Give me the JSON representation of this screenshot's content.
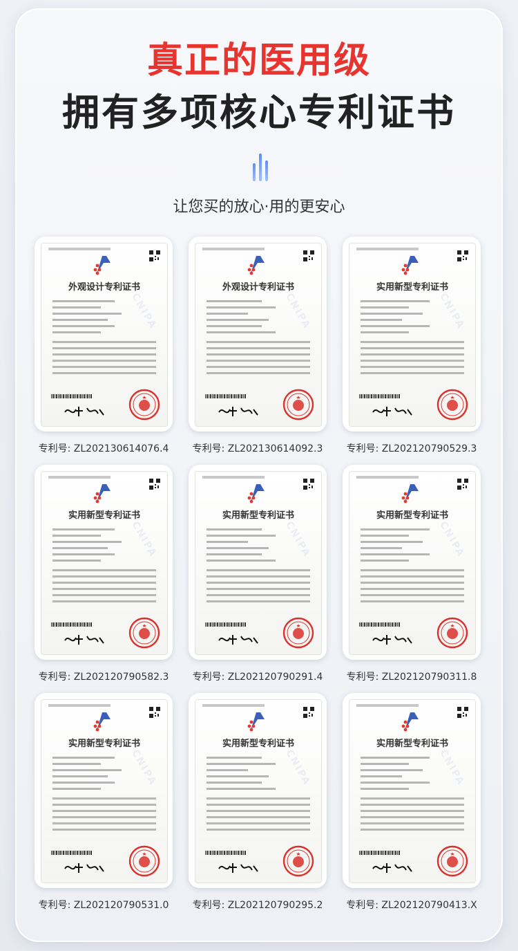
{
  "header": {
    "title_red": "真正的医用级",
    "title_black": "拥有多项核心专利证书",
    "subtitle": "让您买的放心·用的更安心"
  },
  "colors": {
    "accent_red": "#e8342f",
    "accent_blue": "#3a6fe0",
    "seal_red": "#d9312c"
  },
  "certificates": [
    {
      "cert_title": "外观设计专利证书",
      "caption": "专利号: ZL202130614076.4"
    },
    {
      "cert_title": "外观设计专利证书",
      "caption": "专利号: ZL202130614092.3"
    },
    {
      "cert_title": "实用新型专利证书",
      "caption": "专利号: ZL202120790529.3"
    },
    {
      "cert_title": "实用新型专利证书",
      "caption": "专利号: ZL202120790582.3"
    },
    {
      "cert_title": "实用新型专利证书",
      "caption": "专利号: ZL202120790291.4"
    },
    {
      "cert_title": "实用新型专利证书",
      "caption": "专利号: ZL202120790311.8"
    },
    {
      "cert_title": "实用新型专利证书",
      "caption": "专利号: ZL202120790531.0"
    },
    {
      "cert_title": "实用新型专利证书",
      "caption": "专利号: ZL202120790295.2"
    },
    {
      "cert_title": "实用新型专利证书",
      "caption": "专利号: ZL202120790413.X"
    }
  ]
}
